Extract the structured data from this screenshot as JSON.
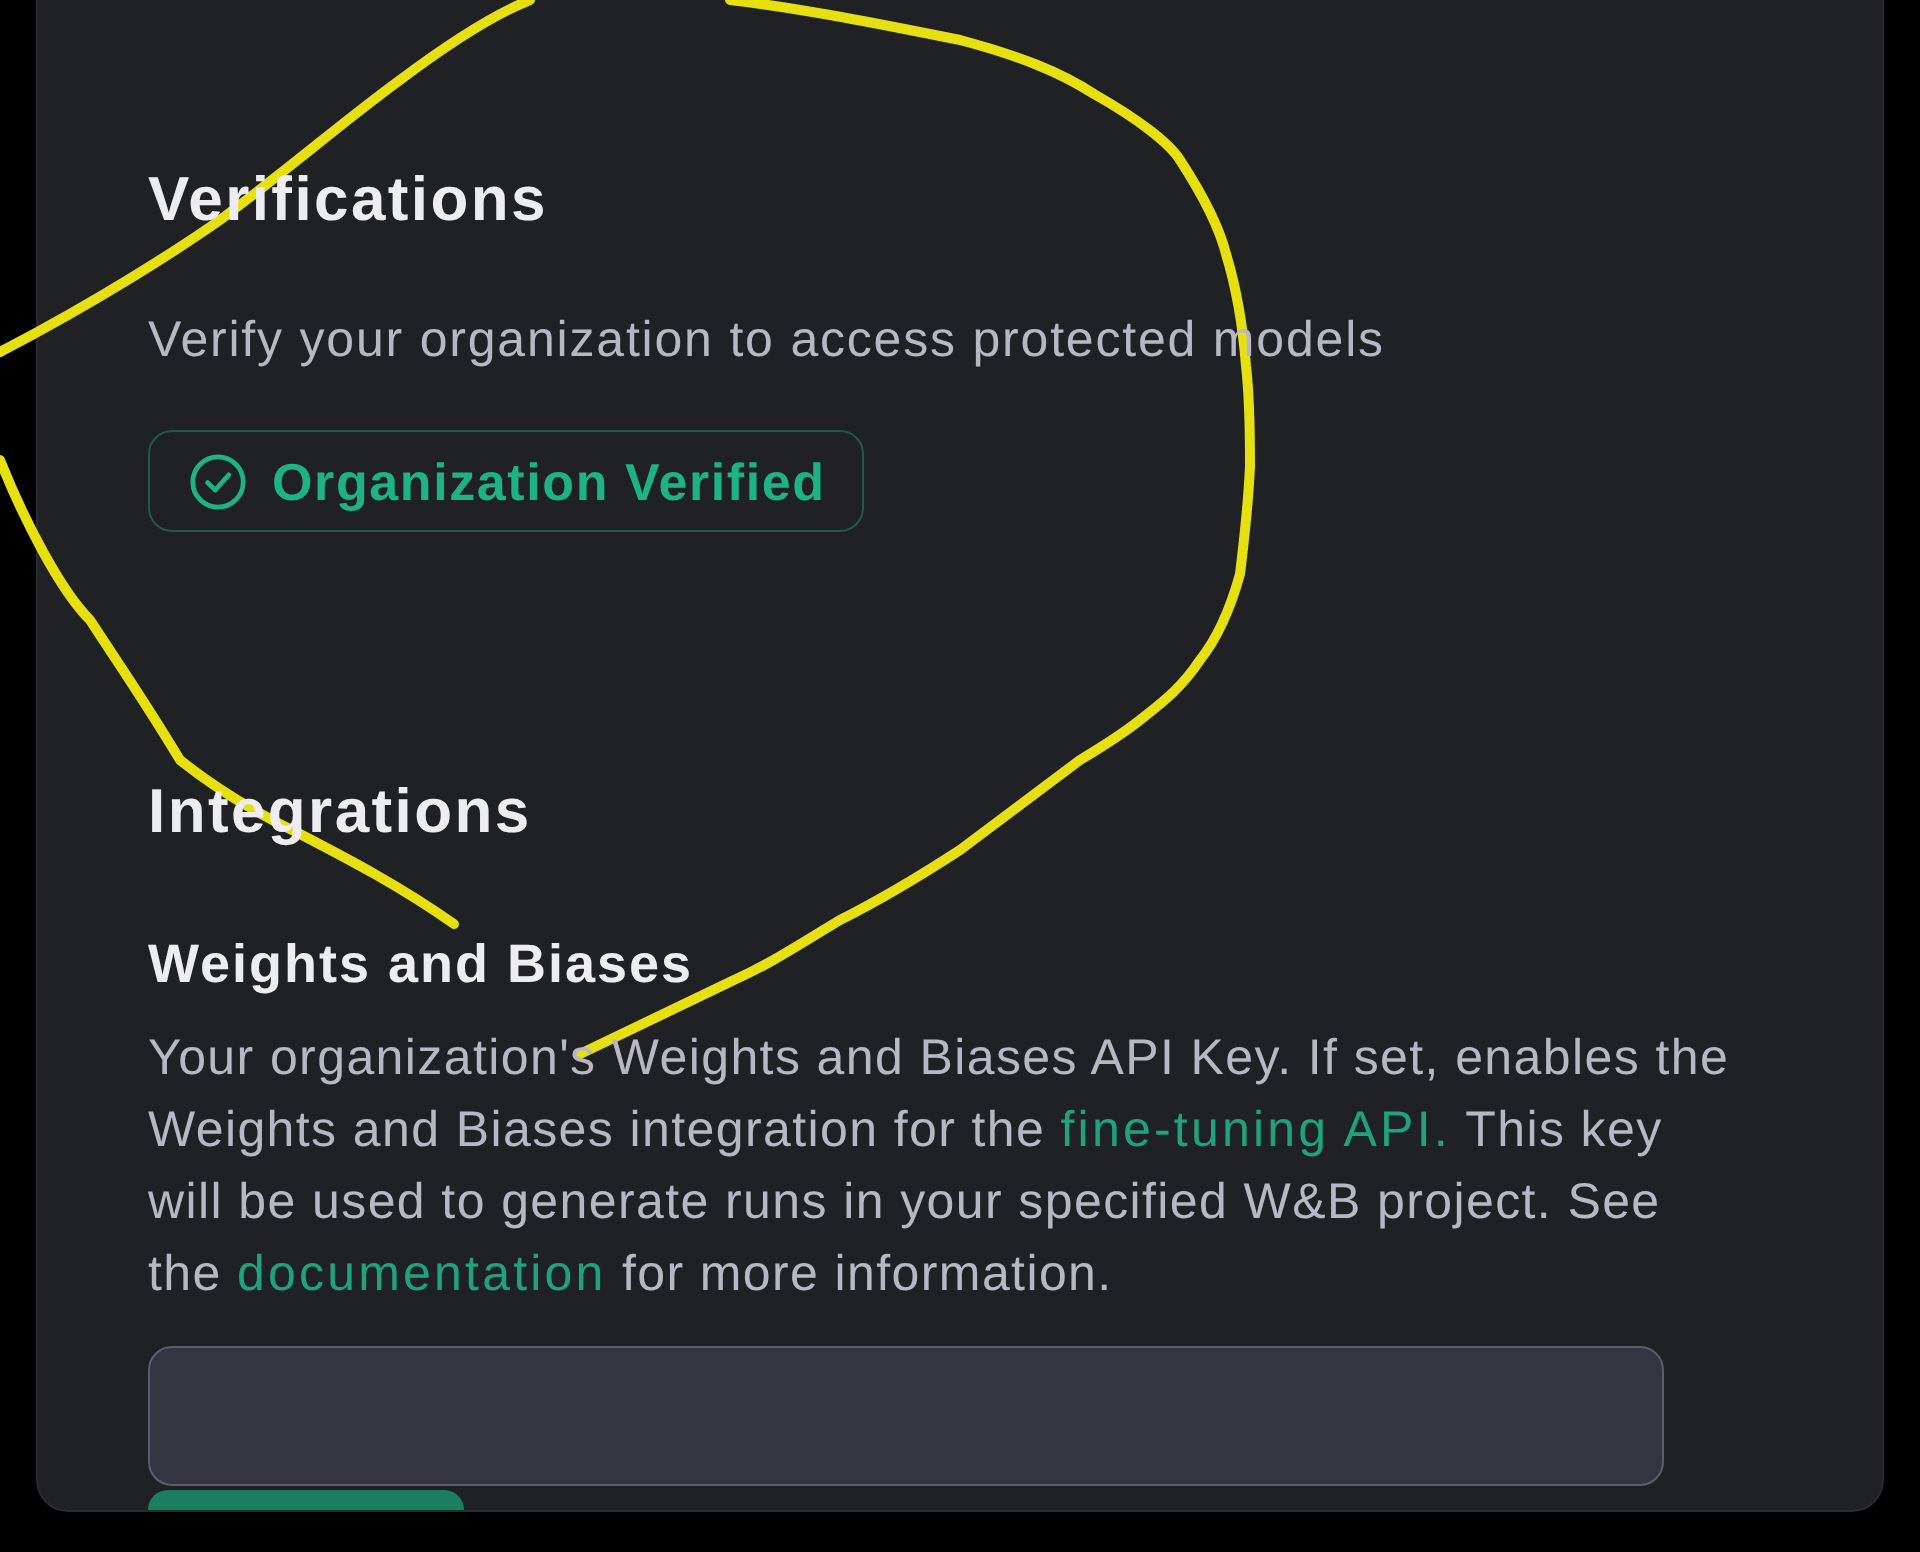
{
  "verifications": {
    "title": "Verifications",
    "subtitle": "Verify your organization to access protected models",
    "status_badge": {
      "label": "Organization Verified",
      "verified": true
    }
  },
  "integrations": {
    "title": "Integrations",
    "items": [
      {
        "name": "Weights and Biases",
        "description": [
          {
            "kind": "text",
            "text": "Your organization's Weights and Biases API Key. If set, enables the Weights and Biases integration for the "
          },
          {
            "kind": "link",
            "text": "fine-tuning API."
          },
          {
            "kind": "text",
            "text": " This key will be used to generate runs in your specified W&B project. See the "
          },
          {
            "kind": "link",
            "text": "documentation"
          },
          {
            "kind": "text",
            "text": " for more information."
          }
        ]
      }
    ]
  }
}
